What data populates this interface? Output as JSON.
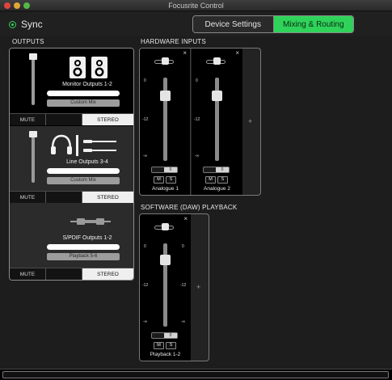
{
  "window": {
    "title": "Focusrite Control"
  },
  "topbar": {
    "sync_label": "Sync",
    "tabs": [
      {
        "label": "Device Settings",
        "active": false
      },
      {
        "label": "Mixing & Routing",
        "active": true
      }
    ]
  },
  "colors": {
    "accent": "#2fd35a",
    "panel": "#000000",
    "background": "#1d1d1d"
  },
  "outputs": {
    "title": "OUTPUTS",
    "panels": [
      {
        "name": "Monitor Outputs 1-2",
        "source": "Custom Mix",
        "mute_label": "MUTE",
        "stereo_label": "STEREO",
        "icon": "speakers-icon"
      },
      {
        "name": "Line Outputs 3-4",
        "source": "Custom Mix",
        "mute_label": "MUTE",
        "stereo_label": "STEREO",
        "icon": "headphones-cable-icon"
      },
      {
        "name": "S/PDIF Outputs 1-2",
        "source": "Playback 5-6",
        "mute_label": "MUTE",
        "stereo_label": "STEREO",
        "icon": "spdif-cable-icon"
      }
    ]
  },
  "hardware_inputs": {
    "title": "HARDWARE INPUTS",
    "channels": [
      {
        "name": "Analogue 1",
        "gain_value": "0",
        "mute": "M",
        "solo": "S",
        "scale": [
          "0",
          "-12",
          "-∞"
        ],
        "close": "×"
      },
      {
        "name": "Analogue 2",
        "gain_value": "0",
        "mute": "M",
        "solo": "S",
        "scale": [
          "0",
          "-12",
          "-∞"
        ],
        "close": "×"
      }
    ],
    "add_label": "+"
  },
  "daw_playback": {
    "title": "SOFTWARE (DAW) PLAYBACK",
    "channels": [
      {
        "name": "Playback 1-2",
        "gain_value": "0",
        "mute": "M",
        "solo": "S",
        "scale": [
          "0",
          "-12",
          "-∞"
        ],
        "close": "×"
      }
    ],
    "add_label": "+"
  }
}
